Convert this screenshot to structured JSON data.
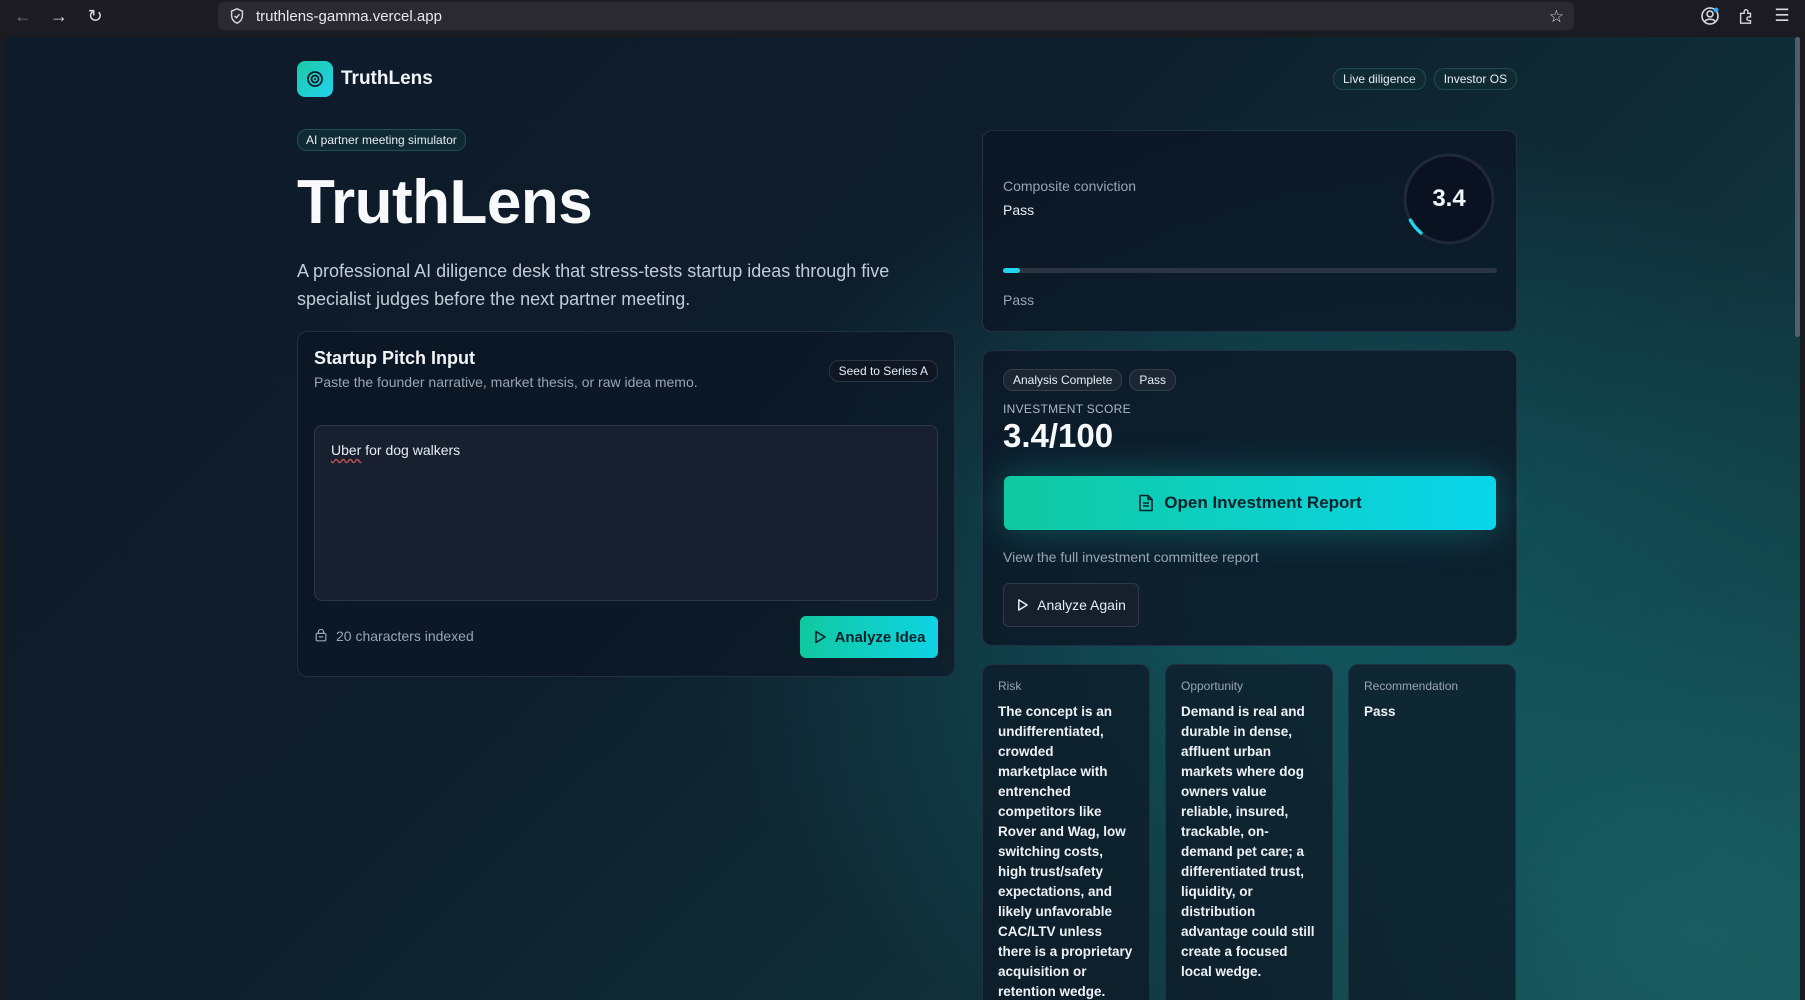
{
  "browser": {
    "url": "truthlens-gamma.vercel.app"
  },
  "header": {
    "brand": "TruthLens",
    "badges": [
      "Live diligence",
      "Investor OS"
    ]
  },
  "hero": {
    "badge": "AI partner meeting simulator",
    "title": "TruthLens",
    "subtitle": "A professional AI diligence desk that stress-tests startup ideas through five specialist judges before the next partner meeting."
  },
  "pitch": {
    "title": "Startup Pitch Input",
    "description": "Paste the founder narrative, market thesis, or raw idea memo.",
    "stage_badge": "Seed to Series A",
    "input_word_flagged": "Uber",
    "input_rest": " for dog walkers",
    "char_count": "20 characters indexed",
    "analyze_label": "Analyze Idea"
  },
  "conviction": {
    "label": "Composite conviction",
    "verdict": "Pass",
    "score": "3.4",
    "progress_percent": 3.4,
    "footer": "Pass"
  },
  "report": {
    "status_badge": "Analysis Complete",
    "verdict_badge": "Pass",
    "score_label": "INVESTMENT SCORE",
    "score_value": "3.4/100",
    "open_report_label": "Open Investment Report",
    "hint": "View the full investment committee report",
    "analyze_again_label": "Analyze Again"
  },
  "judges": [
    {
      "label": "Risk",
      "text": "The concept is an undifferentiated, crowded marketplace with entrenched competitors like Rover and Wag, low switching costs, high trust/safety expectations, and likely unfavorable CAC/LTV unless there is a proprietary acquisition or retention wedge."
    },
    {
      "label": "Opportunity",
      "text": "Demand is real and durable in dense, affluent urban markets where dog owners value reliable, insured, trackable, on-demand pet care; a differentiated trust, liquidity, or distribution advantage could still create a focused local wedge."
    },
    {
      "label": "Recommendation",
      "text": "Pass"
    }
  ],
  "colors": {
    "accent_start": "#10c9a0",
    "accent_end": "#0ad6ec",
    "card_bg": "#0c1624"
  }
}
